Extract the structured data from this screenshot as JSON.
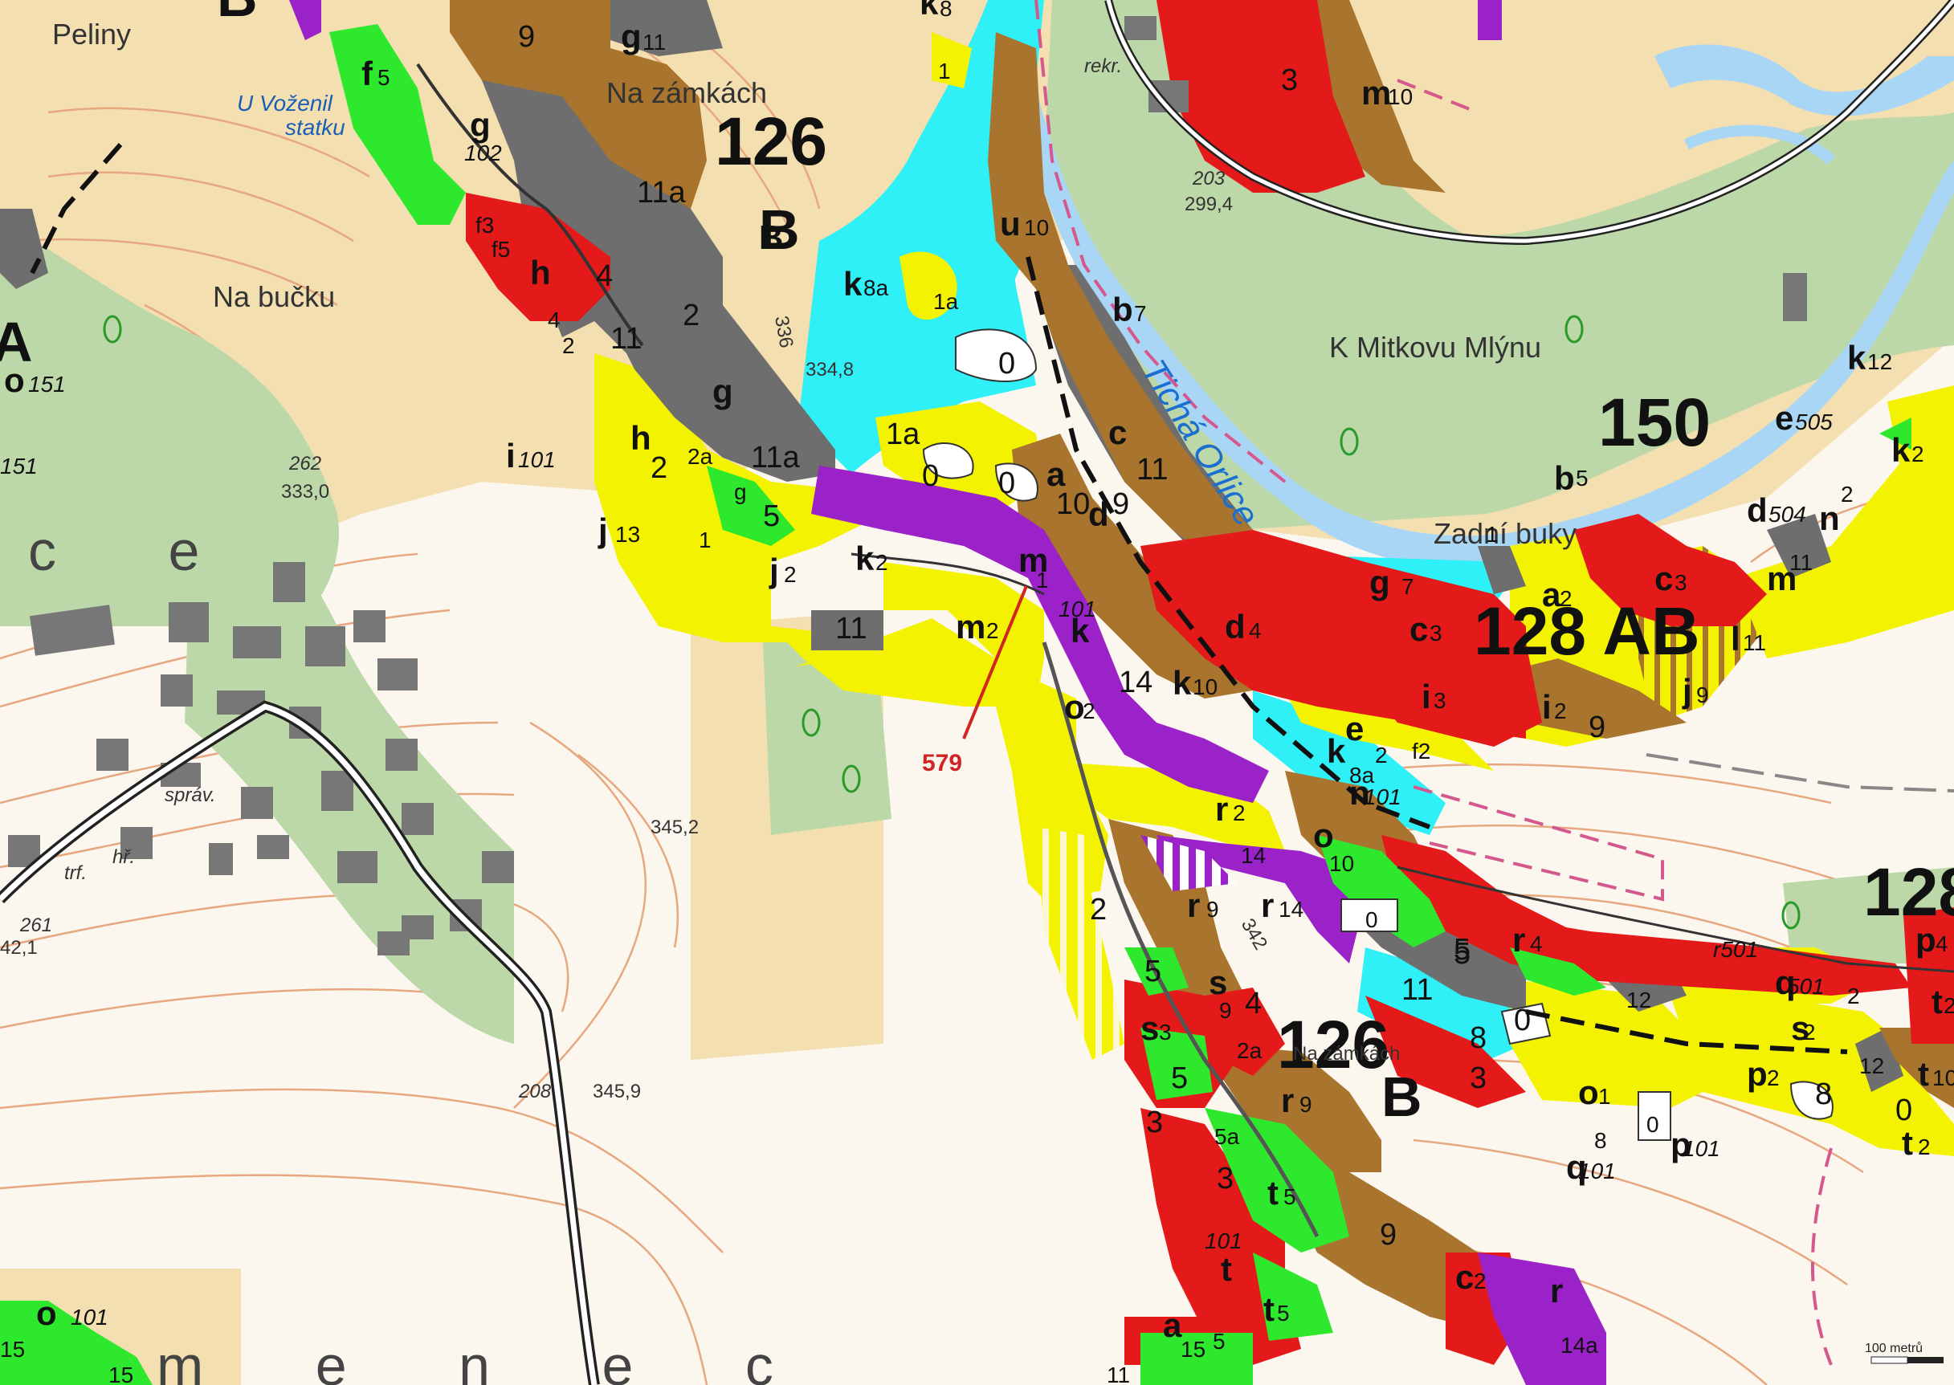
{
  "colors": {
    "background": "#fbf7ee",
    "light_tan": "#f3dfb0",
    "green_forest": "#bcd8a8",
    "yellow": "#f3f200",
    "grey": "#6e6e6e",
    "brown": "#a8742e",
    "red": "#e41a1a",
    "purple": "#9b22c8",
    "cyan": "#2ff0f6",
    "bright_green": "#2ee82e",
    "river": "#aad6f5",
    "contour": "#e7a77f",
    "marker_red": "#d12424"
  },
  "compartments": {
    "c126_top": "126",
    "b_top": "B",
    "c126_bottom": "126",
    "b_bottom": "B",
    "c150": "150",
    "c128_ab": "128 AB",
    "c128_right": "128",
    "a_left": "A",
    "b_top_left": "B"
  },
  "places": {
    "peliny": "Peliny",
    "u_vozenil_1": "U Voženil",
    "u_vozenil_2": "statku",
    "na_zamkach": "Na zámkách",
    "na_bucku": "Na bučku",
    "k_mitkovu": "K Mitkovu Mlýnu",
    "zadni_buky": "Zadní buky",
    "na_zamkach_2": "Na zámkách",
    "rekr": "rekr.",
    "sprav": "správ.",
    "trf": "trf.",
    "hr": "hř.",
    "river": "Tichá Orlice",
    "ghost_left": "c e",
    "ghost_bottom": "m e n e c"
  },
  "elevations": {
    "e_203": "203",
    "e_299": "299,4",
    "e_262": "262",
    "e_333": "333,0",
    "e_336": "336",
    "e_334": "334,8",
    "e_345_2": "345,2",
    "e_208": "208",
    "e_345_9": "345,9",
    "e_261": "261",
    "e_42": "42,1",
    "e_342": "342"
  },
  "marker": {
    "label": "579"
  },
  "scale": {
    "label": "100 metrů"
  },
  "units": {
    "u1": "9",
    "u2": "g",
    "u3": "11",
    "u4": "k",
    "u5": "8",
    "u6": "f",
    "u7": "5",
    "u8": "g",
    "u9": "102",
    "u10": "11a",
    "u11": "B",
    "u12": "k",
    "u13": "8a",
    "u14": "1a",
    "u15": "u",
    "u16": "10",
    "u17": "1",
    "u18": "3",
    "u19": "m",
    "u20": "10",
    "u21": "f3",
    "u22": "f5",
    "u23": "h",
    "u24": "4",
    "u25": "4",
    "u26": "2",
    "u27": "11",
    "u28": "o",
    "u29": "151",
    "u30": "i",
    "u31": "101",
    "u32": "2",
    "u33": "0",
    "u34": "b",
    "u35": "7",
    "u36": "g",
    "u37": "11a",
    "u38": "1a",
    "u39": "h",
    "u40": "2",
    "u41": "2a",
    "u42": "g",
    "u43": "5",
    "u44": "0",
    "u45": "0",
    "u46": "c",
    "u47": "11",
    "u48": "a",
    "u49": "10",
    "u50": "d",
    "u51": "9",
    "u52": "j",
    "u53": "13",
    "u54": "1",
    "u55": "j",
    "u56": "2",
    "u57": "k",
    "u58": "2",
    "u59": "m",
    "u60": "1",
    "u61": "11",
    "u62": "m",
    "u63": "2",
    "u64": "101",
    "u65": "k",
    "u66": "14",
    "u67": "k",
    "u68": "10",
    "u69": "d",
    "u70": "4",
    "u71": "c",
    "u72": "3",
    "u73": "i",
    "u74": "3",
    "u75": "i",
    "u76": "2",
    "u77": "9",
    "u78": "a",
    "u79": "2",
    "u80": "g",
    "u81": "7",
    "u82": "1",
    "u83": "c",
    "u84": "3",
    "u85": "m",
    "u86": "11",
    "u87": "l",
    "u88": "11",
    "u89": "j",
    "u90": "9",
    "u91": "d",
    "u92": "504",
    "u93": "e",
    "u94": "505",
    "u95": "k",
    "u96": "12",
    "u97": "k",
    "u98": "2",
    "u99": "n",
    "u100": "2",
    "u101": "b",
    "u102": "5",
    "u103": "o",
    "u104": "2",
    "u105": "r",
    "u106": "2",
    "u107": "e",
    "u108": "2",
    "u109": "f2",
    "u110": "k",
    "u111": "8a",
    "u112": "n",
    "u113": "101",
    "u114": "o",
    "u115": "10",
    "u116": "r",
    "u117": "9",
    "u118": "r",
    "u119": "14",
    "u120": "14",
    "u121": "0",
    "u122": "2",
    "u123": "5",
    "u124": "s",
    "u125": "9",
    "u126": "4",
    "u127": "s",
    "u128": "3",
    "u129": "2a",
    "u130": "5",
    "u131": "r",
    "u132": "9",
    "u133": "3",
    "u134": "5a",
    "u135": "3",
    "u136": "t",
    "u137": "5",
    "u138": "101",
    "u139": "t",
    "u140": "t",
    "u141": "5",
    "u142": "9",
    "u143": "c",
    "u144": "2",
    "u145": "r",
    "u146": "14a",
    "u147": "15",
    "u148": "5",
    "u149": "a",
    "u150": "11",
    "u151": "5",
    "u152": "11",
    "u153": "8",
    "u154": "3",
    "u155": "5",
    "u156": "r",
    "u157": "4",
    "u158": "0",
    "u159": "12",
    "u160": "r501",
    "u161": "q",
    "u162": "501",
    "u163": "2",
    "u164": "p",
    "u165": "4",
    "u166": "t",
    "u167": "2",
    "u168": "s",
    "u169": "2",
    "u170": "o",
    "u171": "1",
    "u172": "p",
    "u173": "2",
    "u174": "8",
    "u175": "12",
    "u176": "0",
    "u177": "t",
    "u178": "10",
    "u179": "t",
    "u180": "2",
    "u181": "8",
    "u182": "0",
    "u183": "q",
    "u184": "101",
    "u185": "p",
    "u186": "101",
    "u187": "o",
    "u188": "101",
    "u189": "15",
    "u190": "15",
    "u191": "151"
  }
}
